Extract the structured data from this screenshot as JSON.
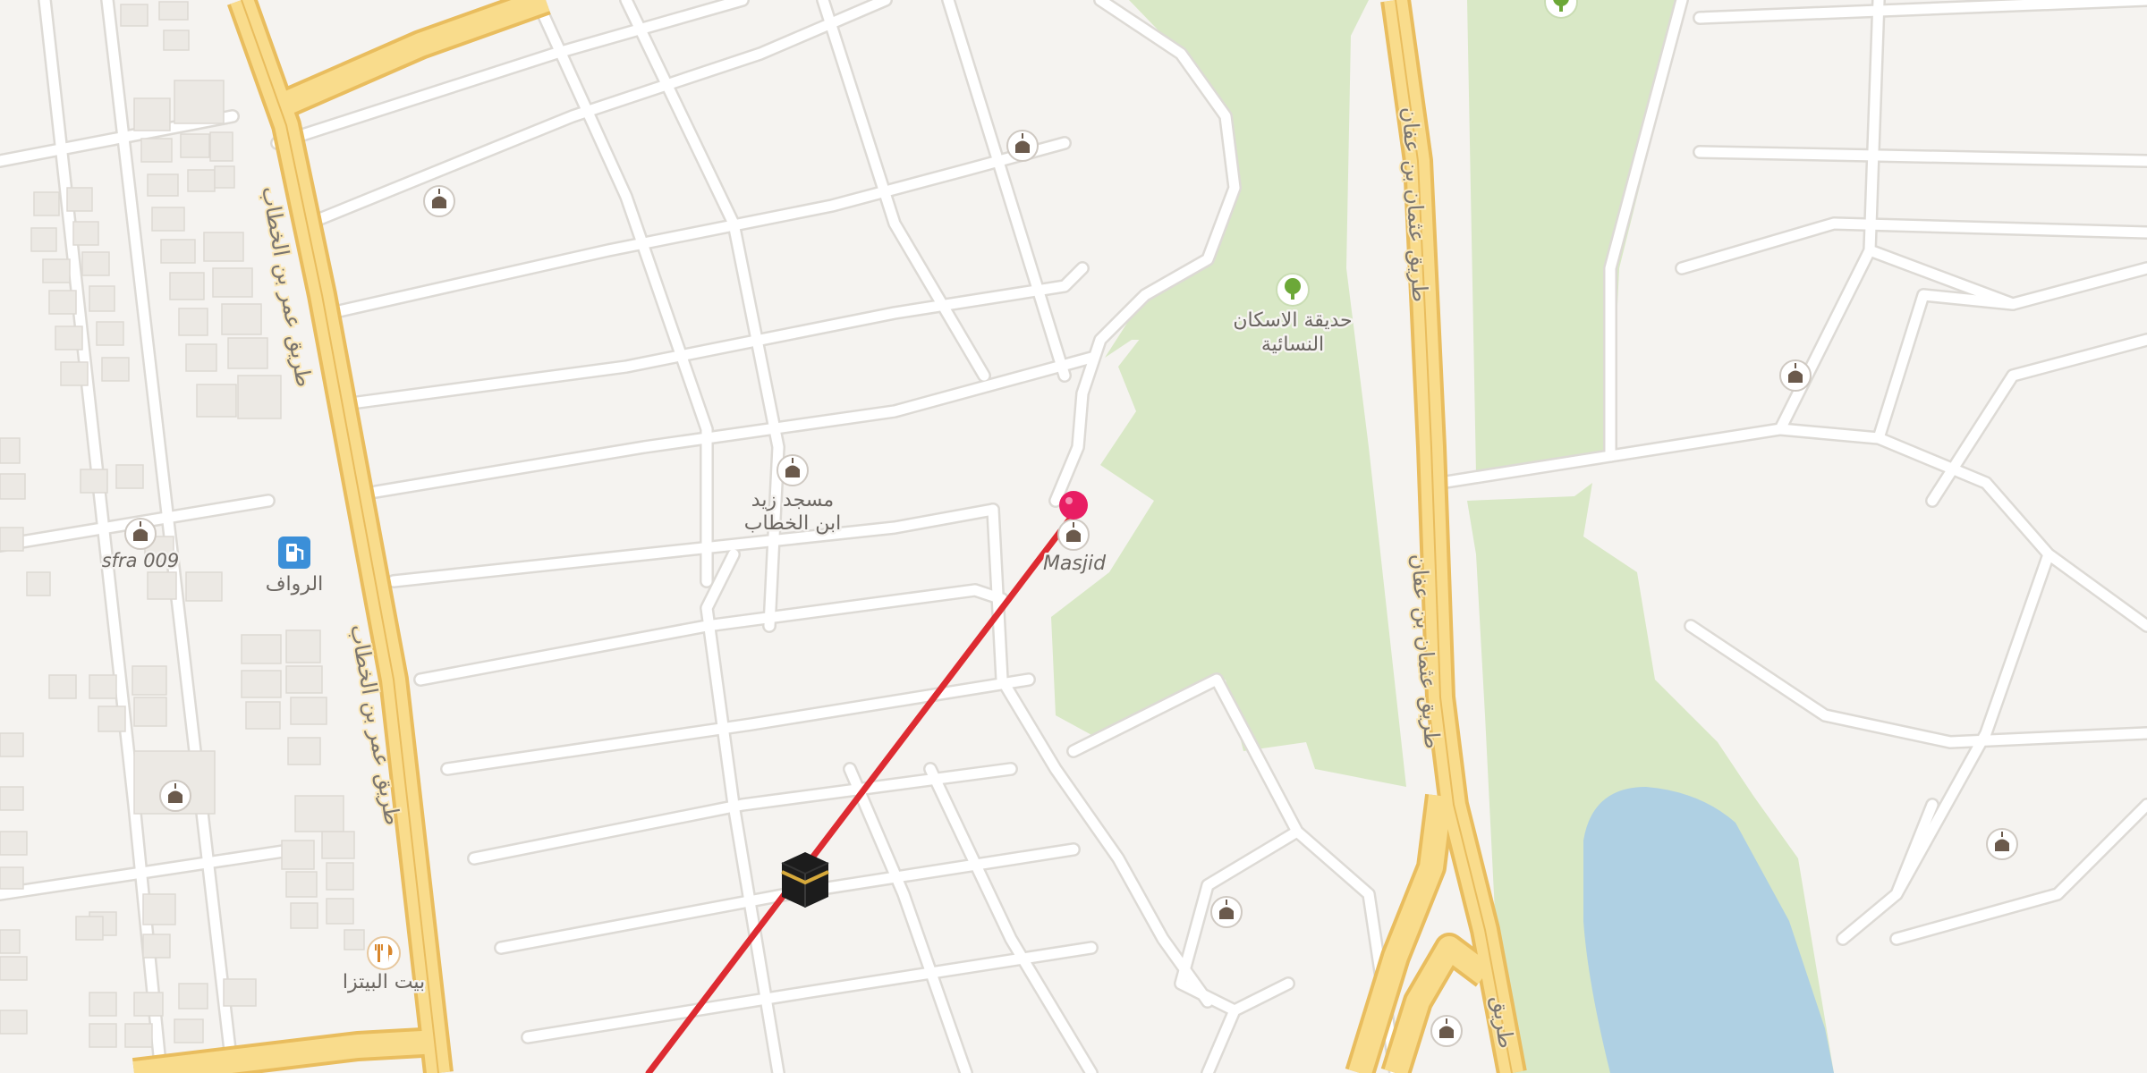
{
  "map": {
    "colors": {
      "land": "#f5f3f0",
      "block": "#f8f6f3",
      "road": "#ffffff",
      "road_edge": "#dddad5",
      "major_road": "#f9dc8c",
      "major_road_edge": "#e9bd5e",
      "park": "#d9e8c6",
      "water": "#afd0e3",
      "building": "#ece9e4",
      "route": "#dd2b31",
      "pin": "#e81d63",
      "poi_icon": "#6b5a4c",
      "fuel": "#3b8fd8",
      "food": "#d9872d",
      "tree": "#6ca838"
    },
    "streets": {
      "left_1": "طريق عمر بن الخطاب",
      "left_2": "طريق عمر بن الخطاب",
      "right_1": "طريق عثمان بن عفان",
      "right_2": "طريق عثمان بن عفان",
      "bottom": "طريق"
    },
    "pois": {
      "park_name_1": "حديقة الاسكان",
      "park_name_2": "النسائية",
      "mosque_zaid_1": "مسجد زيد",
      "mosque_zaid_2": "ابن الخطاب",
      "masjid": "Masjid",
      "sfra": "sfra 009",
      "fuel": "الرواف",
      "restaurant": "بيت البيتزا"
    },
    "icons": {
      "mosque": "mosque-icon",
      "fuel": "fuel-station-icon",
      "food": "fork-knife-icon",
      "park": "tree-icon",
      "kaaba": "kaaba-icon",
      "pin": "location-pin-icon"
    }
  }
}
